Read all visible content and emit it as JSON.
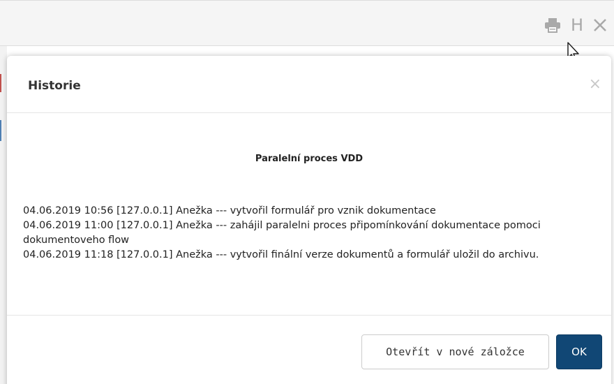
{
  "toolbar": {
    "icons": [
      "printer-icon",
      "letter-h-icon",
      "close-icon"
    ],
    "h_label": "H",
    "close_glyph": "✕"
  },
  "modal": {
    "title": "Historie",
    "close_glyph": "×",
    "process_title": "Paralelní proces VDD",
    "entries": [
      "04.06.2019 10:56 [127.0.0.1] Anežka --- vytvořil formulář pro vznik dokumentace",
      "04.06.2019 11:00 [127.0.0.1] Anežka --- zahájil paralelni proces připomínkování dokumentace pomoci dokumentoveho flow",
      "04.06.2019 11:18 [127.0.0.1] Anežka --- vytvořil finální verze dokumentů a formulář uložil do archivu."
    ],
    "buttons": {
      "open_new_tab": "Otevřít v nové záložce",
      "ok": "OK"
    }
  },
  "colors": {
    "primary_button": "#114775",
    "toolbar_icon": "#a9a9a9",
    "header_border": "#e5e5e5"
  }
}
